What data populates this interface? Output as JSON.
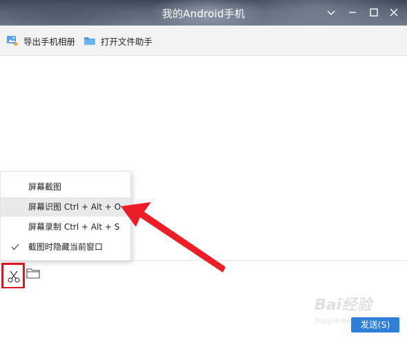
{
  "window": {
    "title": "我的Android手机",
    "controls": [
      "chevron-down",
      "minimize",
      "maximize",
      "close"
    ]
  },
  "toolbar": {
    "export_album_label": "导出手机相册",
    "open_file_assistant_label": "打开文件助手"
  },
  "screenshot_menu": {
    "items": [
      {
        "label": "屏幕截图",
        "checked": false,
        "highlighted": false
      },
      {
        "label": "屏幕识图 Ctrl + Alt + O",
        "checked": false,
        "highlighted": true
      },
      {
        "label": "屏幕录制 Ctrl + Alt + S",
        "checked": false,
        "highlighted": false
      },
      {
        "label": "截图时隐藏当前窗口",
        "checked": true,
        "highlighted": false
      }
    ]
  },
  "input_toolbar": {
    "icons": [
      "scissors-icon",
      "folder-icon"
    ]
  },
  "send_button": {
    "label": "发送(S)"
  },
  "watermark": {
    "brand": "Bai经验",
    "sub": "jingyan.baidu.com"
  },
  "colors": {
    "accent_blue": "#2f7fd8",
    "highlight_red": "#e0141e",
    "menu_hover": "#e9e9e9"
  }
}
